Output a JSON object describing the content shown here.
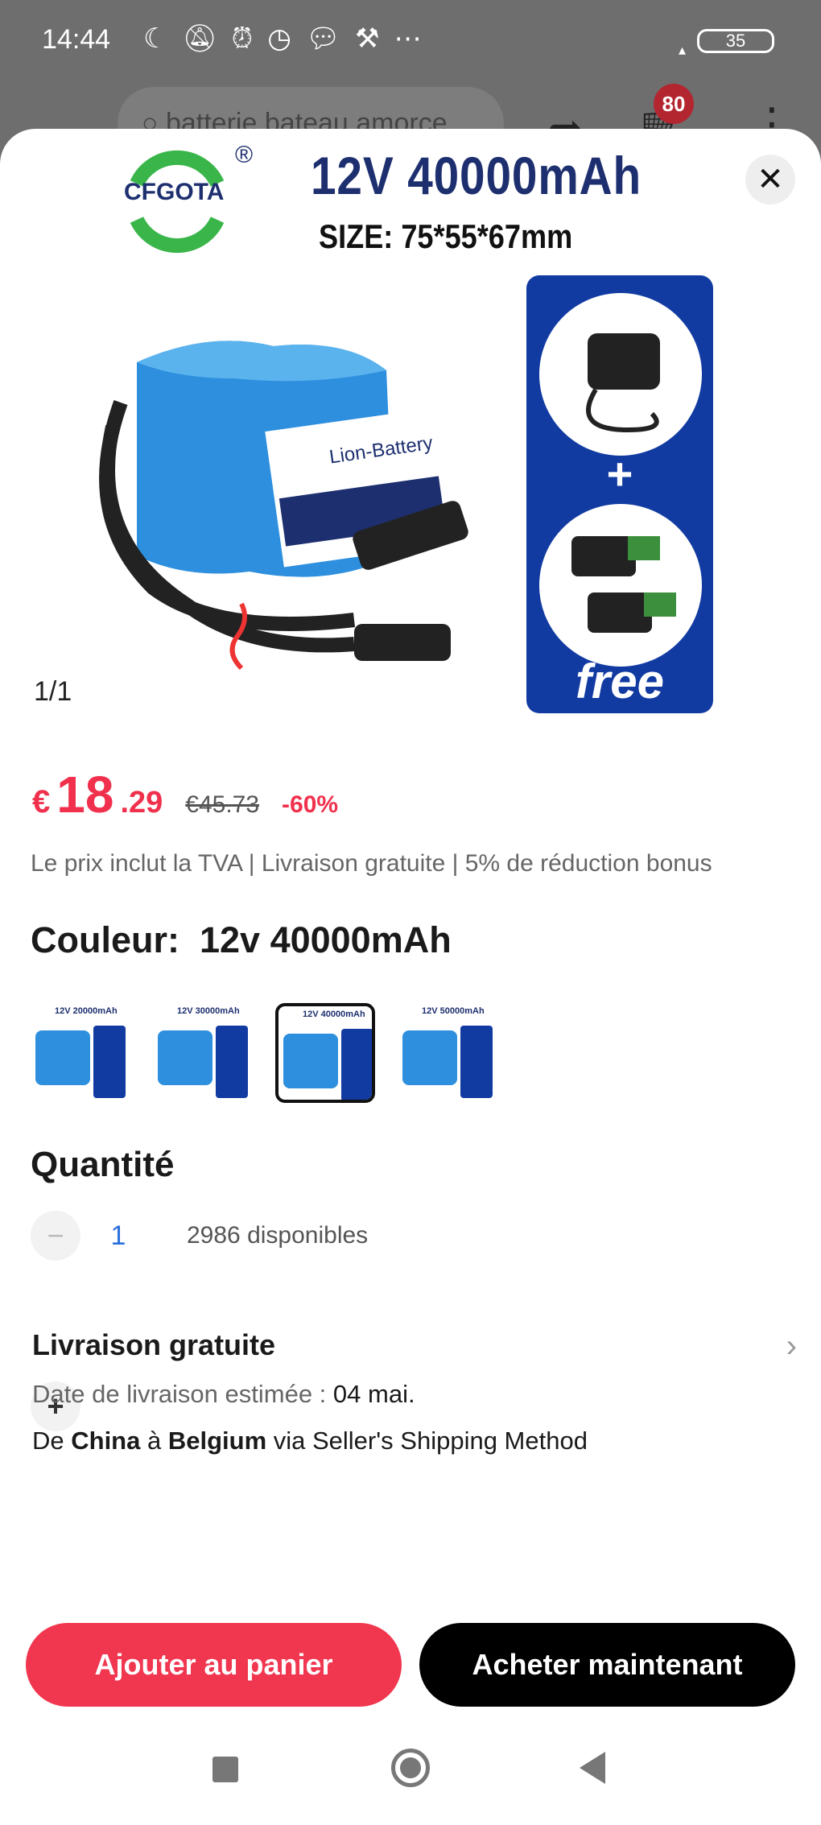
{
  "status_bar": {
    "time": "14:44",
    "icons": [
      "moon-icon",
      "bell-off-icon",
      "alarm-icon",
      "alarm-icon",
      "messenger-icon",
      "tools-icon",
      "more-dots-icon"
    ],
    "battery_level": "35"
  },
  "app_bar": {
    "search_placeholder": "batterie bateau amorce",
    "cart_count": "80"
  },
  "product": {
    "brand": "CFGOTA",
    "brand_mark": "®",
    "title": "12V 40000mAh",
    "size": "SIZE: 75*55*67mm",
    "battery_label": "Lion-Battery",
    "panel_plus": "+",
    "panel_free": "free",
    "image_counter": "1/1"
  },
  "price": {
    "currency": "€",
    "integer": "18",
    "decimal": ".29",
    "original": "€45.73",
    "discount": "-60%"
  },
  "info_line": "Le prix inclut la TVA | Livraison gratuite | 5% de réduction bonus",
  "color": {
    "label": "Couleur:  12v 40000mAh",
    "variants": [
      {
        "title": "12V 20000mAh"
      },
      {
        "title": "12V 30000mAh"
      },
      {
        "title": "12V 40000mAh"
      },
      {
        "title": "12V 50000mAh"
      }
    ],
    "selected_index": 2
  },
  "quantity": {
    "label": "Quantité",
    "minus": "−",
    "value": "1",
    "plus": "+",
    "available": "2986 disponibles"
  },
  "shipping": {
    "title": "Livraison gratuite",
    "date_prefix": "Date de livraison estimée : ",
    "date_value": "04 mai.",
    "route_prefix": "De ",
    "route_from": "China",
    "route_mid": " à ",
    "route_to": "Belgium",
    "route_suffix": " via Seller's Shipping Method"
  },
  "buttons": {
    "add_to_cart": "Ajouter au panier",
    "buy_now": "Acheter maintenant"
  },
  "colors": {
    "accent": "#f1364f",
    "price": "#f0304c",
    "panel_blue": "#123ba2",
    "battery_blue": "#2d8fde"
  }
}
